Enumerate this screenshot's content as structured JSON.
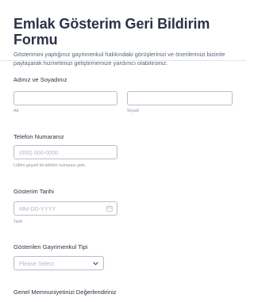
{
  "header": {
    "title": "Emlak Gösterim Geri Bildirim Formu",
    "subtitle": "Gösterimini yaptığınız gayrimenkul hakkındaki görüşlerinizi ve önerilerinizi bizimle paylaşarak hizmetimizi geliştirmemize yardımcı olabilirsiniz."
  },
  "name_field": {
    "label": "Adınız ve Soyadınız",
    "first_value": "",
    "last_value": "",
    "first_sublabel": "Ad",
    "last_sublabel": "Soyad"
  },
  "phone_field": {
    "label": "Telefon Numaranız",
    "placeholder": "(000) 000-0000",
    "sublabel": "Lütfen geçerli bir telefon numarası girin."
  },
  "date_field": {
    "label": "Gösterim Tarihi",
    "placeholder": "MM-DD-YYYY",
    "sublabel": "Tarih",
    "icon": "calendar-icon"
  },
  "property_type_field": {
    "label": "Gösterilen Gayrimenkul Tipi",
    "selected": "Please Select",
    "icon": "chevron-down-icon"
  },
  "satisfaction_field": {
    "label": "Genel Memnuniyetinizi Değerlendiriniz"
  },
  "colors": {
    "text": "#2c3345",
    "subtitle": "#57647e",
    "border": "#b8bdc9",
    "placeholder": "#b3b8c5"
  }
}
